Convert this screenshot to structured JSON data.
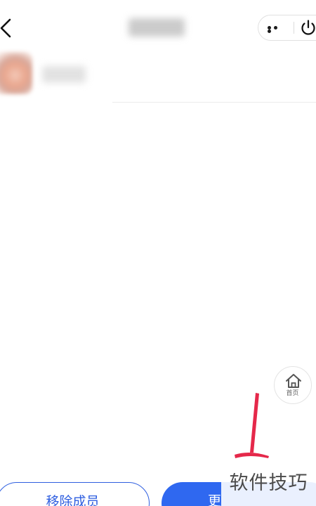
{
  "header": {
    "title": "   ",
    "more_icon": "more-horizontal-icon",
    "power_icon": "power-icon",
    "back_icon": "chevron-left-icon"
  },
  "member": {
    "name": "   "
  },
  "home_float": {
    "label": "首页",
    "icon": "home-icon"
  },
  "buttons": {
    "remove_label": "移除成员",
    "primary_label": "更"
  },
  "watermark": "软件技巧",
  "colors": {
    "accent": "#2f68f0",
    "outline": "#2f5fe0",
    "annotation": "#e5284a"
  }
}
